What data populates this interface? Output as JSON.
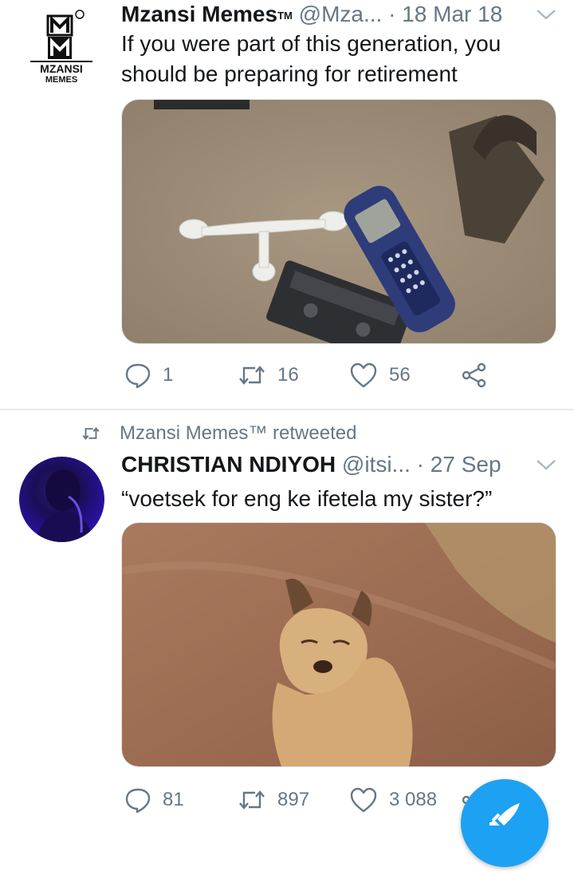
{
  "tweets": [
    {
      "author_name": "Mzansi Memes",
      "trademark": "TM",
      "handle": "@Mza...",
      "separator": "·",
      "date": "18 Mar 18",
      "text_lines": [
        "If you were part of this generation, you",
        "should be preparing for retirement"
      ],
      "logo": {
        "letters": "MM",
        "line1": "MZANSI",
        "line2": "MEMES",
        "tm": "TM"
      },
      "media_alt": "photo-cassette-phone-iron",
      "actions": {
        "reply_count": "1",
        "retweet_count": "16",
        "like_count": "56"
      }
    },
    {
      "retweeted_by": "Mzansi Memes™ retweeted",
      "author_name": "CHRISTIAN NDIYOH",
      "handle": "@itsi...",
      "separator": "·",
      "date": "27 Sep",
      "text_lines": [
        "“voetsek for eng ke ifetela my sister?”"
      ],
      "media_alt": "photo-dog",
      "actions": {
        "reply_count": "81",
        "retweet_count": "897",
        "like_count": "3 088"
      }
    }
  ],
  "colors": {
    "accent": "#1da1f2",
    "muted": "#657786",
    "text": "#14171a",
    "divider": "#e6ecf0"
  },
  "icons": [
    "reply-icon",
    "retweet-icon",
    "like-icon",
    "share-icon",
    "chevron-down-icon",
    "compose-icon"
  ]
}
